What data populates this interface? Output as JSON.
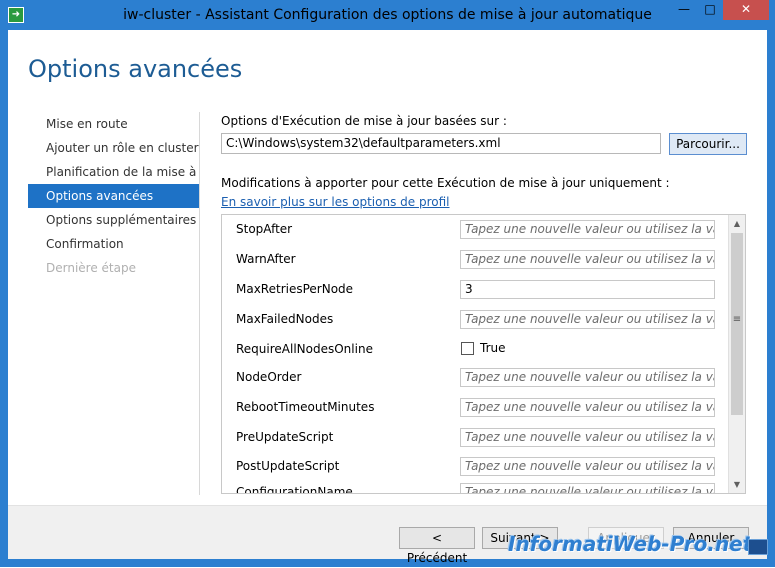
{
  "window": {
    "title": "iw-cluster - Assistant Configuration des options de mise à jour automatique",
    "controls": {
      "minimize": "—",
      "maximize": "□",
      "close": "✕"
    }
  },
  "page": {
    "title": "Options avancées"
  },
  "nav": {
    "items": [
      {
        "label": "Mise en route",
        "state": "normal"
      },
      {
        "label": "Ajouter un rôle en cluster",
        "state": "normal"
      },
      {
        "label": "Planification de la mise à jour",
        "state": "normal"
      },
      {
        "label": "Options avancées",
        "state": "active"
      },
      {
        "label": "Options supplémentaires",
        "state": "normal"
      },
      {
        "label": "Confirmation",
        "state": "normal"
      },
      {
        "label": "Dernière étape",
        "state": "disabled"
      }
    ]
  },
  "content": {
    "profile_label": "Options d'Exécution de mise à jour basées sur :",
    "profile_path": "C:\\Windows\\system32\\defaultparameters.xml",
    "browse_label": "Parcourir...",
    "mods_label": "Modifications à apporter pour cette Exécution de mise à jour uniquement :",
    "profile_link": "En savoir plus sur les options de profil"
  },
  "params": [
    {
      "name": "StopAfter",
      "type": "text",
      "value": "",
      "placeholder": "Tapez une nouvelle valeur ou utilisez la valeur..."
    },
    {
      "name": "WarnAfter",
      "type": "text",
      "value": "",
      "placeholder": "Tapez une nouvelle valeur ou utilisez la valeur..."
    },
    {
      "name": "MaxRetriesPerNode",
      "type": "text",
      "value": "3",
      "placeholder": ""
    },
    {
      "name": "MaxFailedNodes",
      "type": "text",
      "value": "",
      "placeholder": "Tapez une nouvelle valeur ou utilisez la valeur..."
    },
    {
      "name": "RequireAllNodesOnline",
      "type": "checkbox",
      "value": "True",
      "checked": false
    },
    {
      "name": "NodeOrder",
      "type": "text",
      "value": "",
      "placeholder": "Tapez une nouvelle valeur ou utilisez la valeur..."
    },
    {
      "name": "RebootTimeoutMinutes",
      "type": "text",
      "value": "",
      "placeholder": "Tapez une nouvelle valeur ou utilisez la valeur..."
    },
    {
      "name": "PreUpdateScript",
      "type": "text",
      "value": "",
      "placeholder": "Tapez une nouvelle valeur ou utilisez la valeur..."
    },
    {
      "name": "PostUpdateScript",
      "type": "text",
      "value": "",
      "placeholder": "Tapez une nouvelle valeur ou utilisez la valeur..."
    },
    {
      "name": "ConfigurationName",
      "type": "text",
      "value": "",
      "placeholder": "Tapez une nouvelle valeur ou utilisez la valeur..."
    }
  ],
  "scrollbar": {
    "grip": "≡",
    "up": "▲",
    "down": "▼"
  },
  "footer": {
    "previous": "< Précédent",
    "next": "Suivant >",
    "apply": "Appliquer",
    "cancel": "Annuler"
  },
  "watermark": "InformatiWeb-Pro.net",
  "colors": {
    "titlebar": "#2c7fd0",
    "accent": "#1e72c6",
    "title_text": "#1d5c94",
    "link": "#1b5fb0"
  }
}
